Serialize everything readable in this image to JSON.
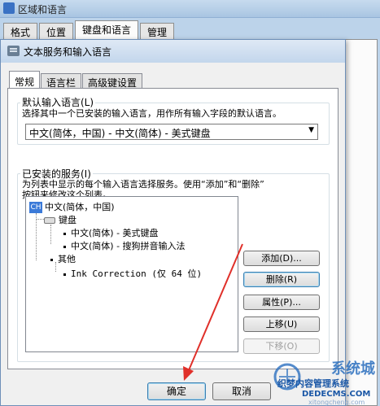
{
  "parent_window": {
    "title": "区域和语言",
    "tabs": [
      "格式",
      "位置",
      "键盘和语言",
      "管理"
    ]
  },
  "dialog": {
    "title": "文本服务和输入语言",
    "tabs": [
      "常规",
      "语言栏",
      "高级键设置"
    ],
    "default_lang": {
      "label": "默认输入语言(L)",
      "description": "选择其中一个已安装的输入语言，用作所有输入字段的默认语言。",
      "selected": "中文(简体，中国) - 中文(简体) - 美式键盘"
    },
    "installed": {
      "label": "已安装的服务(I)",
      "description_line1": "为列表中显示的每个输入语言选择服务。使用“添加”和“删除”",
      "description_line2": "按钮来修改这个列表。",
      "tree": {
        "lang_badge": "CH",
        "language": "中文(简体，中国)",
        "keyboard_group": "键盘",
        "keyboard_items": [
          "中文(简体) - 美式键盘",
          "中文(简体) - 搜狗拼音输入法"
        ],
        "other_group": "其他",
        "other_items": [
          "Ink Correction (仅 64 位)"
        ]
      }
    },
    "buttons": {
      "add": "添加(D)...",
      "remove": "删除(R)",
      "properties": "属性(P)...",
      "move_up": "上移(U)",
      "move_down": "下移(O)",
      "ok": "确定",
      "cancel": "取消"
    }
  },
  "watermark": {
    "brand": "系统城",
    "title": "织梦内容管理系统",
    "url": "DEDECMS.COM",
    "faint": "xitongcheng.com"
  },
  "colors": {
    "arrow": "#e0302a",
    "accent": "#3c7fb1"
  }
}
